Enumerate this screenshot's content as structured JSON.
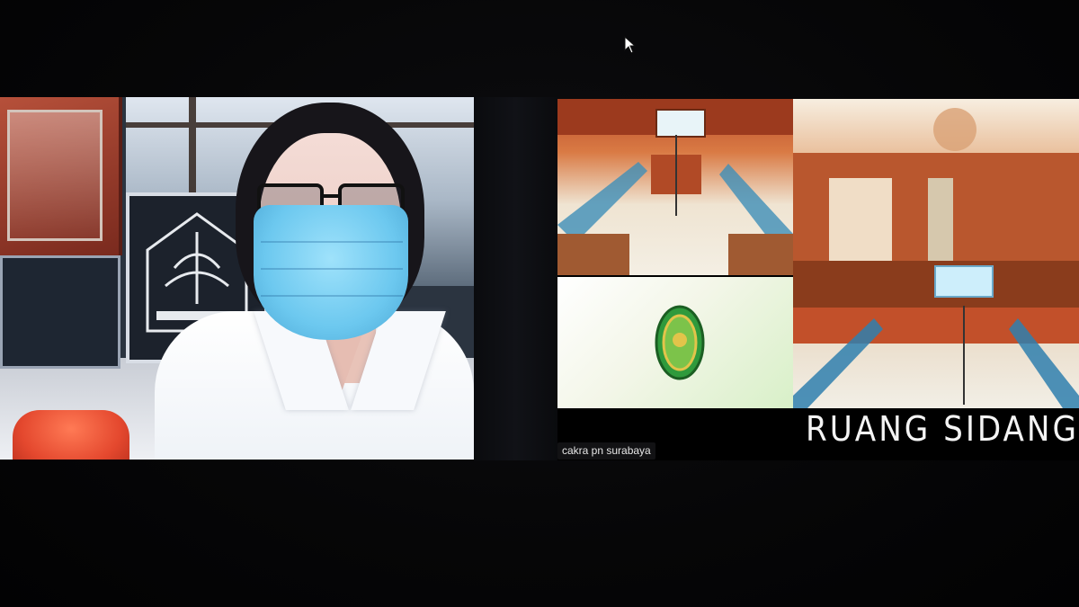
{
  "meeting": {
    "participants": [
      {
        "role": "speaker-left",
        "name_label": ""
      },
      {
        "role": "court-room-feed",
        "name_label": "cakra pn surabaya"
      }
    ]
  },
  "court_feed": {
    "caption": "RUANG SIDANG"
  },
  "icons": {
    "cursor": "mouse-pointer-icon",
    "emblem": "court-emblem-icon"
  },
  "colors": {
    "background": "#050506",
    "mask": "#6cc8ef",
    "caption_text": "#f4f4f4",
    "court_wood": "#c4582e"
  }
}
